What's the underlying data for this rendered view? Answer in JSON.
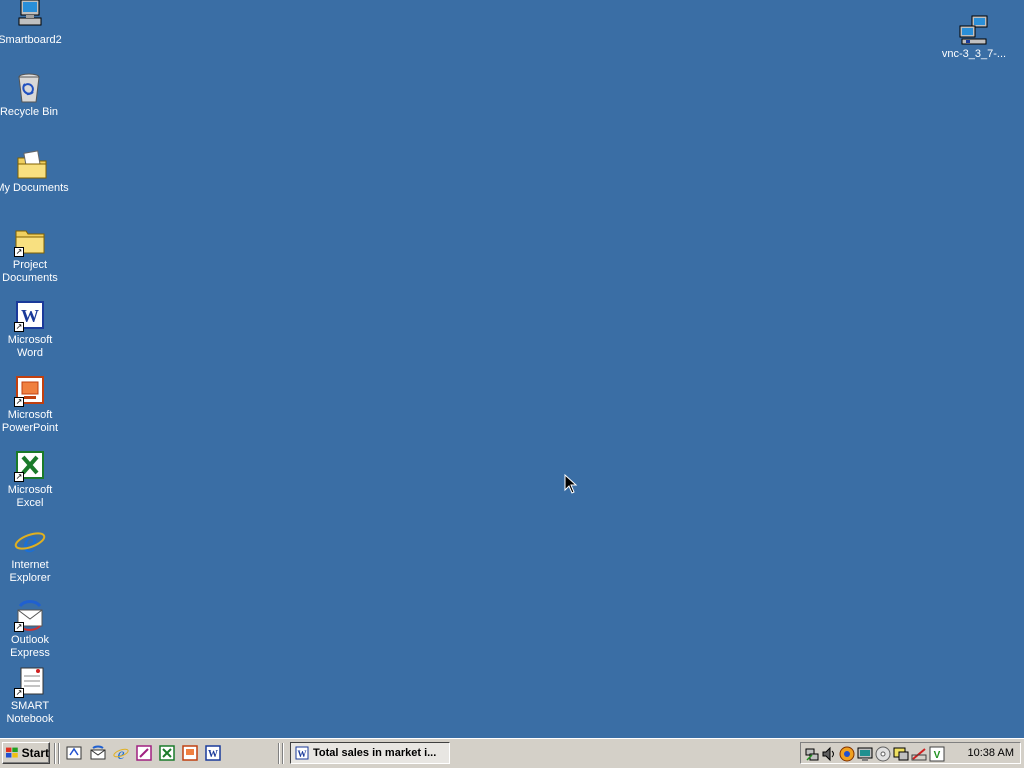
{
  "desktop": {
    "icons": [
      {
        "label": "Smartboard2",
        "icon": "computer-icon"
      },
      {
        "label": "Recycle Bin",
        "icon": "recycle-bin-icon"
      },
      {
        "label": "My Documents",
        "icon": "my-documents-icon"
      },
      {
        "label": "Project\nDocuments",
        "icon": "folder-icon"
      },
      {
        "label": "Microsoft\nWord",
        "icon": "word-icon"
      },
      {
        "label": "Microsoft\nPowerPoint",
        "icon": "powerpoint-icon"
      },
      {
        "label": "Microsoft\nExcel",
        "icon": "excel-icon"
      },
      {
        "label": "Internet\nExplorer",
        "icon": "internet-explorer-icon"
      },
      {
        "label": "Outlook\nExpress",
        "icon": "outlook-express-icon"
      },
      {
        "label": "SMART\nNotebook",
        "icon": "smart-notebook-icon"
      }
    ],
    "right_icon": {
      "label": "vnc-3_3_7-...",
      "icon": "network-computer-icon"
    }
  },
  "taskbar": {
    "start_label": "Start",
    "task_button_label": "Total sales in market i...",
    "clock": "10:38 AM"
  },
  "colors": {
    "desktop": "#3a6ea5",
    "taskbar": "#d4d0c8"
  }
}
